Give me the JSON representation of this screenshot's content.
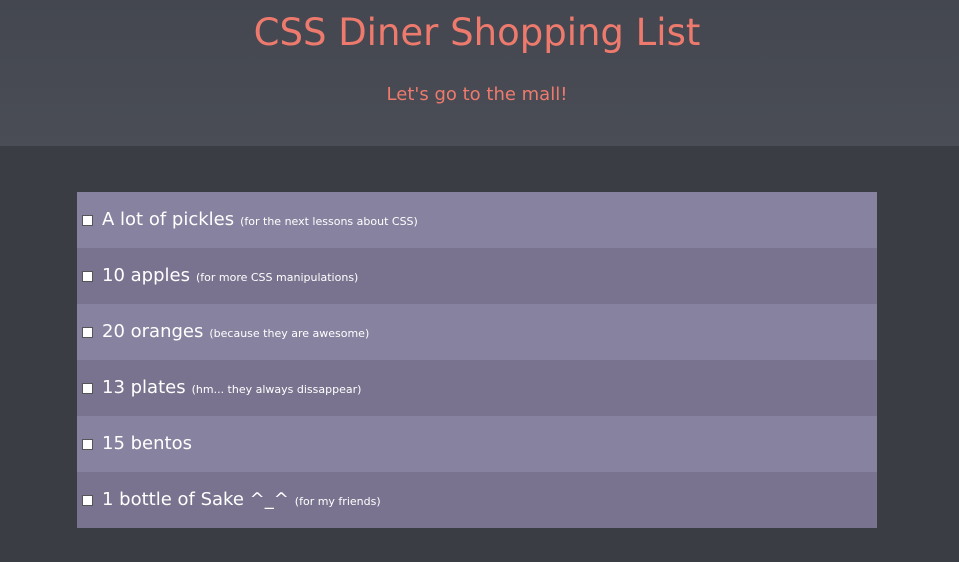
{
  "header": {
    "title": "CSS Diner Shopping List",
    "subtitle": "Let's go to the mall!"
  },
  "colors": {
    "accent": "#ee7a6d",
    "page_background": "#3b3d45",
    "header_background": "#484b53",
    "row_odd": "#87829f",
    "row_even": "#79738f"
  },
  "items": [
    {
      "label": "A lot of pickles",
      "note": "(for the next lessons about CSS)",
      "checked": false
    },
    {
      "label": "10 apples",
      "note": "(for more CSS manipulations)",
      "checked": false
    },
    {
      "label": "20 oranges",
      "note": "(because they are awesome)",
      "checked": false
    },
    {
      "label": "13 plates",
      "note": "(hm... they always dissappear)",
      "checked": false
    },
    {
      "label": "15 bentos",
      "note": "",
      "checked": false
    },
    {
      "label": "1 bottle of Sake ^_^",
      "note": "(for my friends)",
      "checked": false
    }
  ]
}
